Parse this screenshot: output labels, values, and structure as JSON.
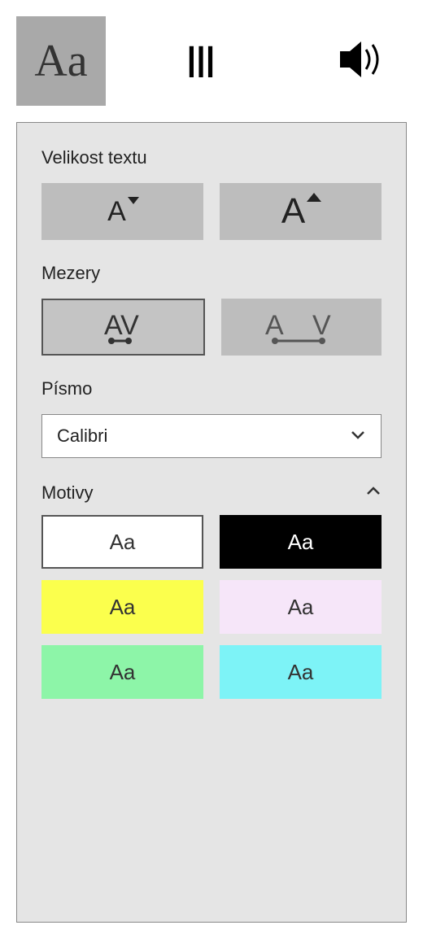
{
  "tabs": {
    "text_tab": "Aa",
    "columns_tab": "III"
  },
  "labels": {
    "text_size": "Velikost textu",
    "spacing": "Mezery",
    "font": "Písmo",
    "themes": "Motivy"
  },
  "font": {
    "selected": "Calibri"
  },
  "theme_sample": "Aa",
  "themes": [
    {
      "bg": "#ffffff",
      "fg": "#333333",
      "selected": true
    },
    {
      "bg": "#000000",
      "fg": "#ffffff",
      "selected": false
    },
    {
      "bg": "#fbff4d",
      "fg": "#333333",
      "selected": false
    },
    {
      "bg": "#f6e6f9",
      "fg": "#333333",
      "selected": false
    },
    {
      "bg": "#8df5a8",
      "fg": "#333333",
      "selected": false
    },
    {
      "bg": "#7df3f7",
      "fg": "#333333",
      "selected": false
    }
  ]
}
